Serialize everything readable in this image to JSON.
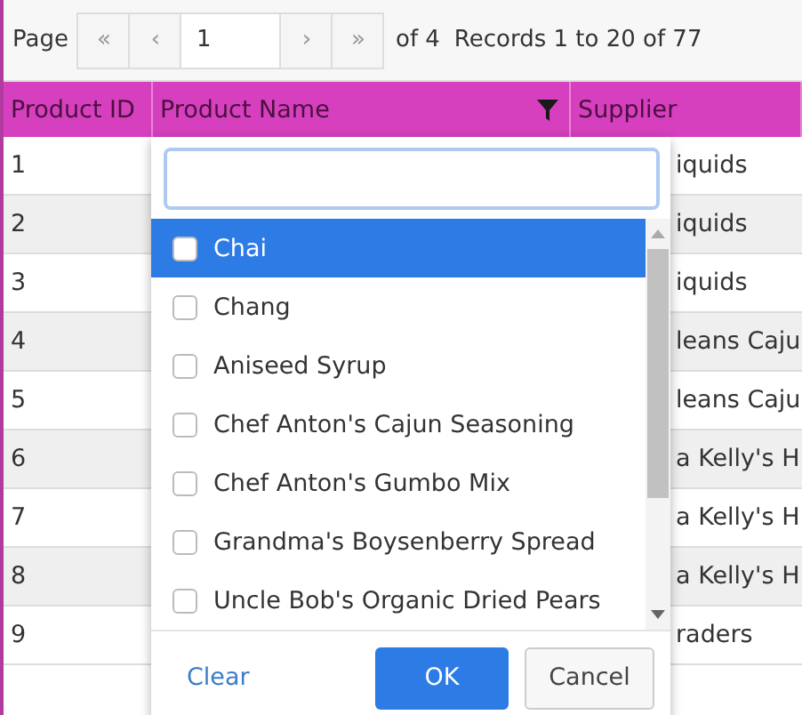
{
  "pager": {
    "label": "Page",
    "first": "«",
    "prev": "‹",
    "page": "1",
    "next": "›",
    "last": "»",
    "of": "of 4",
    "records": "Records 1 to 20 of 77"
  },
  "columns": [
    {
      "label": "Product ID",
      "filtered": false
    },
    {
      "label": "Product Name",
      "filtered": true
    },
    {
      "label": "Supplier",
      "filtered": false
    }
  ],
  "rows": [
    {
      "id": "1",
      "supplier": "iquids"
    },
    {
      "id": "2",
      "supplier": "iquids"
    },
    {
      "id": "3",
      "supplier": "iquids"
    },
    {
      "id": "4",
      "supplier": "leans Caju"
    },
    {
      "id": "5",
      "supplier": "leans Caju"
    },
    {
      "id": "6",
      "supplier": "a Kelly's H"
    },
    {
      "id": "7",
      "supplier": "a Kelly's H"
    },
    {
      "id": "8",
      "supplier": "a Kelly's H"
    },
    {
      "id": "9",
      "supplier": "raders"
    }
  ],
  "filter_popup": {
    "items": [
      {
        "label": "Chai",
        "checked": false,
        "selected": true
      },
      {
        "label": "Chang",
        "checked": false,
        "selected": false
      },
      {
        "label": "Aniseed Syrup",
        "checked": false,
        "selected": false
      },
      {
        "label": "Chef Anton's Cajun Seasoning",
        "checked": false,
        "selected": false
      },
      {
        "label": "Chef Anton's Gumbo Mix",
        "checked": false,
        "selected": false
      },
      {
        "label": "Grandma's Boysenberry Spread",
        "checked": false,
        "selected": false
      },
      {
        "label": "Uncle Bob's Organic Dried Pears",
        "checked": false,
        "selected": false
      }
    ],
    "clear": "Clear",
    "ok": "OK",
    "cancel": "Cancel"
  }
}
